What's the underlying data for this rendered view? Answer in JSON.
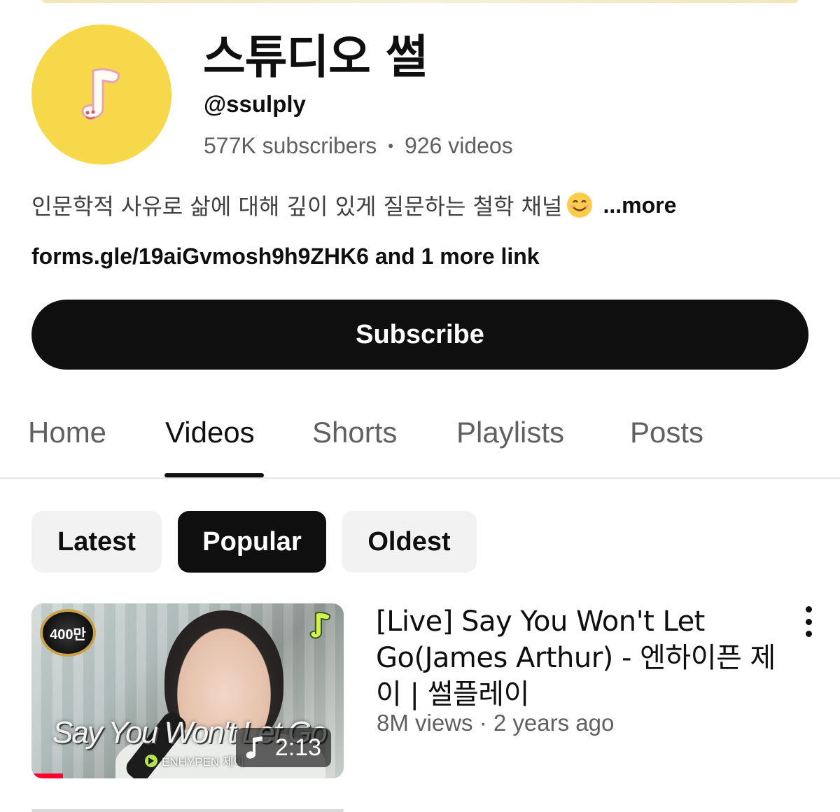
{
  "channel": {
    "title": "스튜디오 썰",
    "handle": "@ssulply",
    "subscribers": "577K subscribers",
    "separator": "•",
    "videos": "926 videos",
    "description": "인문학적 사유로 삶에 대해 깊이 있게 질문하는 철학 채널",
    "description_emoji": "smiling-face-icon",
    "more_label": "...more",
    "links_text": "forms.gle/19aiGvmosh9h9ZHK6 and 1 more link",
    "avatar_color": "#f6d84a",
    "avatar_icon": "music-note-mascot-icon"
  },
  "subscribe_label": "Subscribe",
  "tabs": [
    {
      "label": "Home",
      "active": false
    },
    {
      "label": "Videos",
      "active": true
    },
    {
      "label": "Shorts",
      "active": false
    },
    {
      "label": "Playlists",
      "active": false
    },
    {
      "label": "Posts",
      "active": false
    }
  ],
  "sort_chips": [
    {
      "label": "Latest",
      "selected": false
    },
    {
      "label": "Popular",
      "selected": true
    },
    {
      "label": "Oldest",
      "selected": false
    }
  ],
  "videos": [
    {
      "title": "[Live] Say You Won't Let Go(James Arthur) - 엔하이픈 제이 | 썰플레이",
      "meta": "8M views · 2 years ago",
      "duration": "2:13",
      "thumbnail_badge": "400만",
      "thumbnail_overlay_title": "Say You Won't Let Go",
      "thumbnail_overlay_channel": "ENHYPEN 제이",
      "progress": 0.1
    }
  ],
  "colors": {
    "accent": "#ff0033",
    "text_primary": "#0f0f0f",
    "text_secondary": "#606060",
    "chip_bg": "#f2f2f2"
  }
}
